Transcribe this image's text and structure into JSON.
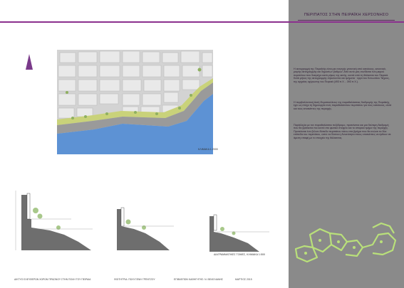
{
  "panel": {
    "title": "ΠΕΡΙΠΑΤΟΣ ΣΤΗΝ ΠΕΙΡΑΪΚΗ ΧΕΡΣΟΝΗΣΟ",
    "paragraphs": [
      "Η ακτογραμμή της Πειραϊκής είναι μια συνεχής γειτονική από κατοίκους, κανονικά, μικρής ακτογραμμής και δημοσίων βαθμών. Από αυτό μας συνδέεται ένα μικρού περιπάτου που διατρέχει κατά μήκος της ακτής, κοντά από τη θάλασσα του Πειραιά. Κατά μήκος της ακτογραμμής σηκώνονται και τμήματα · έργα του Κονωνείου Τείχους, της αρχαίας οχύρωσης του Πειραιά (493 π.Χ. - 393 π.Χ.).",
      "Η περιβαλλοντική Ακτή Θεμιστοκλέους της παραθαλάσσιας διαδρομής της Πειραϊκής, έχει ως στόχο τη δημιουργία ενός παραθαλάσσιου περιπάτου για τους κατοίκους, αλλά και τους επισκέπτες της περιοχής.",
      "Παράλληλα με τον παραθαλάσσιο πεζόδρομο, προτείνεται και μια δεύτερη διαδρομή που θα βρίσκεται πιο κοντά στο φυσικό στοιχείο και το ιστορικό τμήμα της περιοχής. Προτείνεται ένα ξύλινο δάπεδο περιπάτου πάνω στα βράχια που θα ενώνει τα δύο επίπεδα του περιπάτου, ώστε να δίνεται η δυνατότητα στους επισκέπτες να έρθουν σε άμεση επαφή με το στοιχείο της θάλασσας."
    ]
  },
  "map": {
    "caption": "ΚΛΙΜΑΚΑ 1:2000",
    "sea_color": "#5d92d4",
    "land_color": "#cfcfcf",
    "coast_color": "#9a9a9a",
    "green_color": "#c9d27a"
  },
  "sections": {
    "caption": "ΔΙΑΓΡΑΜΜΑΤΙΚΕΣ ΤΟΜΕΣ, ΚΛΙΜΑΚΑ 1:500"
  },
  "footer": {
    "left": "ΔΙΚΤΥΟ ΕΛΕΥΘΕΡΩΝ ΧΩΡΩΝ ΠΡΑΣΙΝΟΥ ΣΤΗΝ ΠΟΛΗ ΤΟΥ ΠΕΙΡΑΙΑ",
    "student": "ΦΟΙΤΗΤΡΙΑ: ΠΟΛΥΞΕΝΗ ΓΡΕΝΤΖΟΥ",
    "professor": "ΕΠΙΒΛΕΠΩΝ ΚΑΘΗΓΗΤΗΣ: Ν. ΒΕΛΕΛΙΑΝΗΣ",
    "date": "ΜΑΡΤΙΟΣ 2015"
  },
  "colors": {
    "accent": "#8b2f8e",
    "panel": "#8a8a8a",
    "section_fill": "#6e6e6e",
    "tree_green": "#a8c88a",
    "siteplan_green": "#b9e07a"
  }
}
